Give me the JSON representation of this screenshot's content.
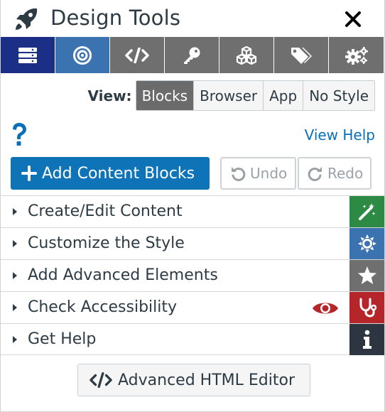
{
  "header": {
    "title": "Design Tools",
    "icon": "rocket-icon",
    "close_icon": "close-icon"
  },
  "tabs": [
    {
      "icon": "blocks-icon",
      "state": "active"
    },
    {
      "icon": "target-icon",
      "state": "selected"
    },
    {
      "icon": "code-icon",
      "state": "default"
    },
    {
      "icon": "key-icon",
      "state": "default"
    },
    {
      "icon": "cubes-icon",
      "state": "default"
    },
    {
      "icon": "tags-icon",
      "state": "default"
    },
    {
      "icon": "gears-icon",
      "state": "default"
    }
  ],
  "view": {
    "label": "View:",
    "options": [
      "Blocks",
      "Browser",
      "App",
      "No Style"
    ],
    "selected": "Blocks"
  },
  "help": {
    "question_icon": "question-icon",
    "view_help": "View Help"
  },
  "actions": {
    "add": "Add Content Blocks",
    "undo": "Undo",
    "redo": "Redo"
  },
  "sections": [
    {
      "label": "Create/Edit Content",
      "icon": "magic-wand-icon",
      "color": "#2d8a45"
    },
    {
      "label": "Customize the Style",
      "icon": "sun-icon",
      "color": "#3b73b0"
    },
    {
      "label": "Add Advanced Elements",
      "icon": "star-icon",
      "color": "#6f6f6f"
    },
    {
      "label": "Check Accessibility",
      "icon": "stethoscope-icon",
      "color": "#b5262a"
    },
    {
      "label": "Get Help",
      "icon": "info-icon",
      "color": "#2d3640"
    }
  ],
  "advanced_editor": "Advanced HTML Editor",
  "colors": {
    "tab_active": "#1b2f86",
    "tab_selected": "#3b73b0",
    "tab_default": "#6f6f6f",
    "primary": "#0f74b7",
    "link": "#0770b8",
    "eye": "#b5262a"
  }
}
